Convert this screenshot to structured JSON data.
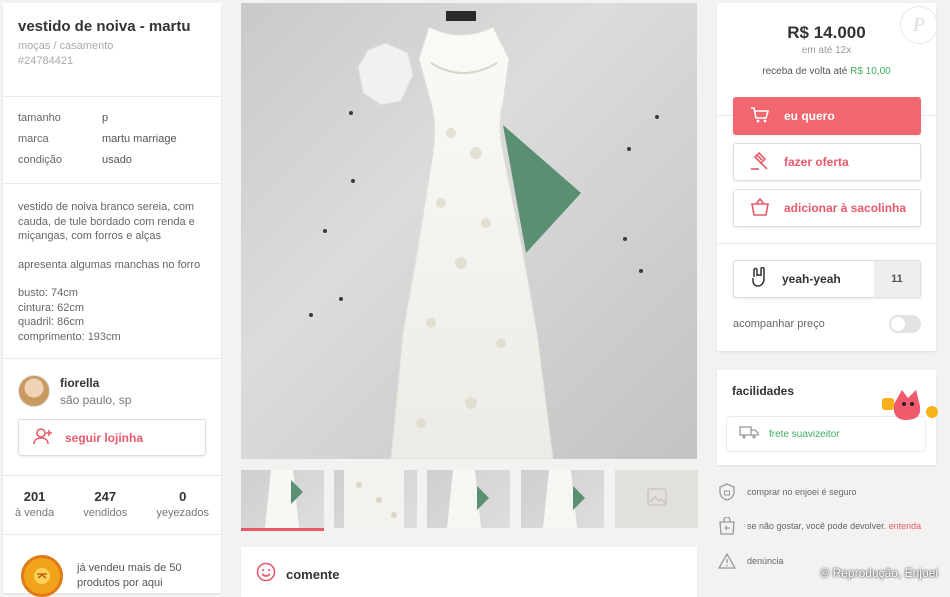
{
  "product": {
    "title": "vestido de noiva - martu",
    "breadcrumb": "moças / casamento",
    "id": "#24784421",
    "attributes": [
      {
        "key": "tamanho",
        "value": "p"
      },
      {
        "key": "marca",
        "value": "martu marriage"
      },
      {
        "key": "condição",
        "value": "usado"
      }
    ],
    "description": [
      "vestido de noiva branco sereia, com cauda, de tule bordado com renda e miçangas, com forros e alças",
      "apresenta algumas manchas no forro",
      "busto: 74cm",
      "cintura: 62cm",
      "quadril: 86cm",
      "comprimento: 193cm"
    ]
  },
  "seller": {
    "name": "fiorella",
    "location": "são paulo, sp",
    "follow_label": "seguir lojinha",
    "stats": [
      {
        "value": "201",
        "label": "à venda"
      },
      {
        "value": "247",
        "label": "vendidos"
      },
      {
        "value": "0",
        "label": "yeyezados"
      }
    ],
    "badge_text": "já vendeu mais de 50 produtos por aqui"
  },
  "gallery": {
    "thumbnail_count": 5,
    "active_index": 0
  },
  "comment": {
    "label": "comente"
  },
  "purchase": {
    "price": "R$ 14.000",
    "installments": "em até 12x",
    "cashback_prefix": "receba de volta até",
    "cashback_value": "R$ 10,00",
    "buy_label": "eu quero",
    "offer_label": "fazer oferta",
    "bag_label": "adicionar à sacolinha",
    "yeah_label": "yeah-yeah",
    "yeah_count": "11",
    "watch_price_label": "acompanhar preço"
  },
  "facilities": {
    "title": "facilidades",
    "shipping_label": "frete suavizeitor"
  },
  "safety": {
    "safe_label": "comprar no enjoei é seguro",
    "return_label": "se não gostar, você pode devolver.",
    "return_link": "entenda",
    "report_label": "denúncia"
  },
  "watermark": "© Reprodução, Enjoei",
  "colors": {
    "accent": "#f2676f",
    "green": "#3fae5f"
  }
}
